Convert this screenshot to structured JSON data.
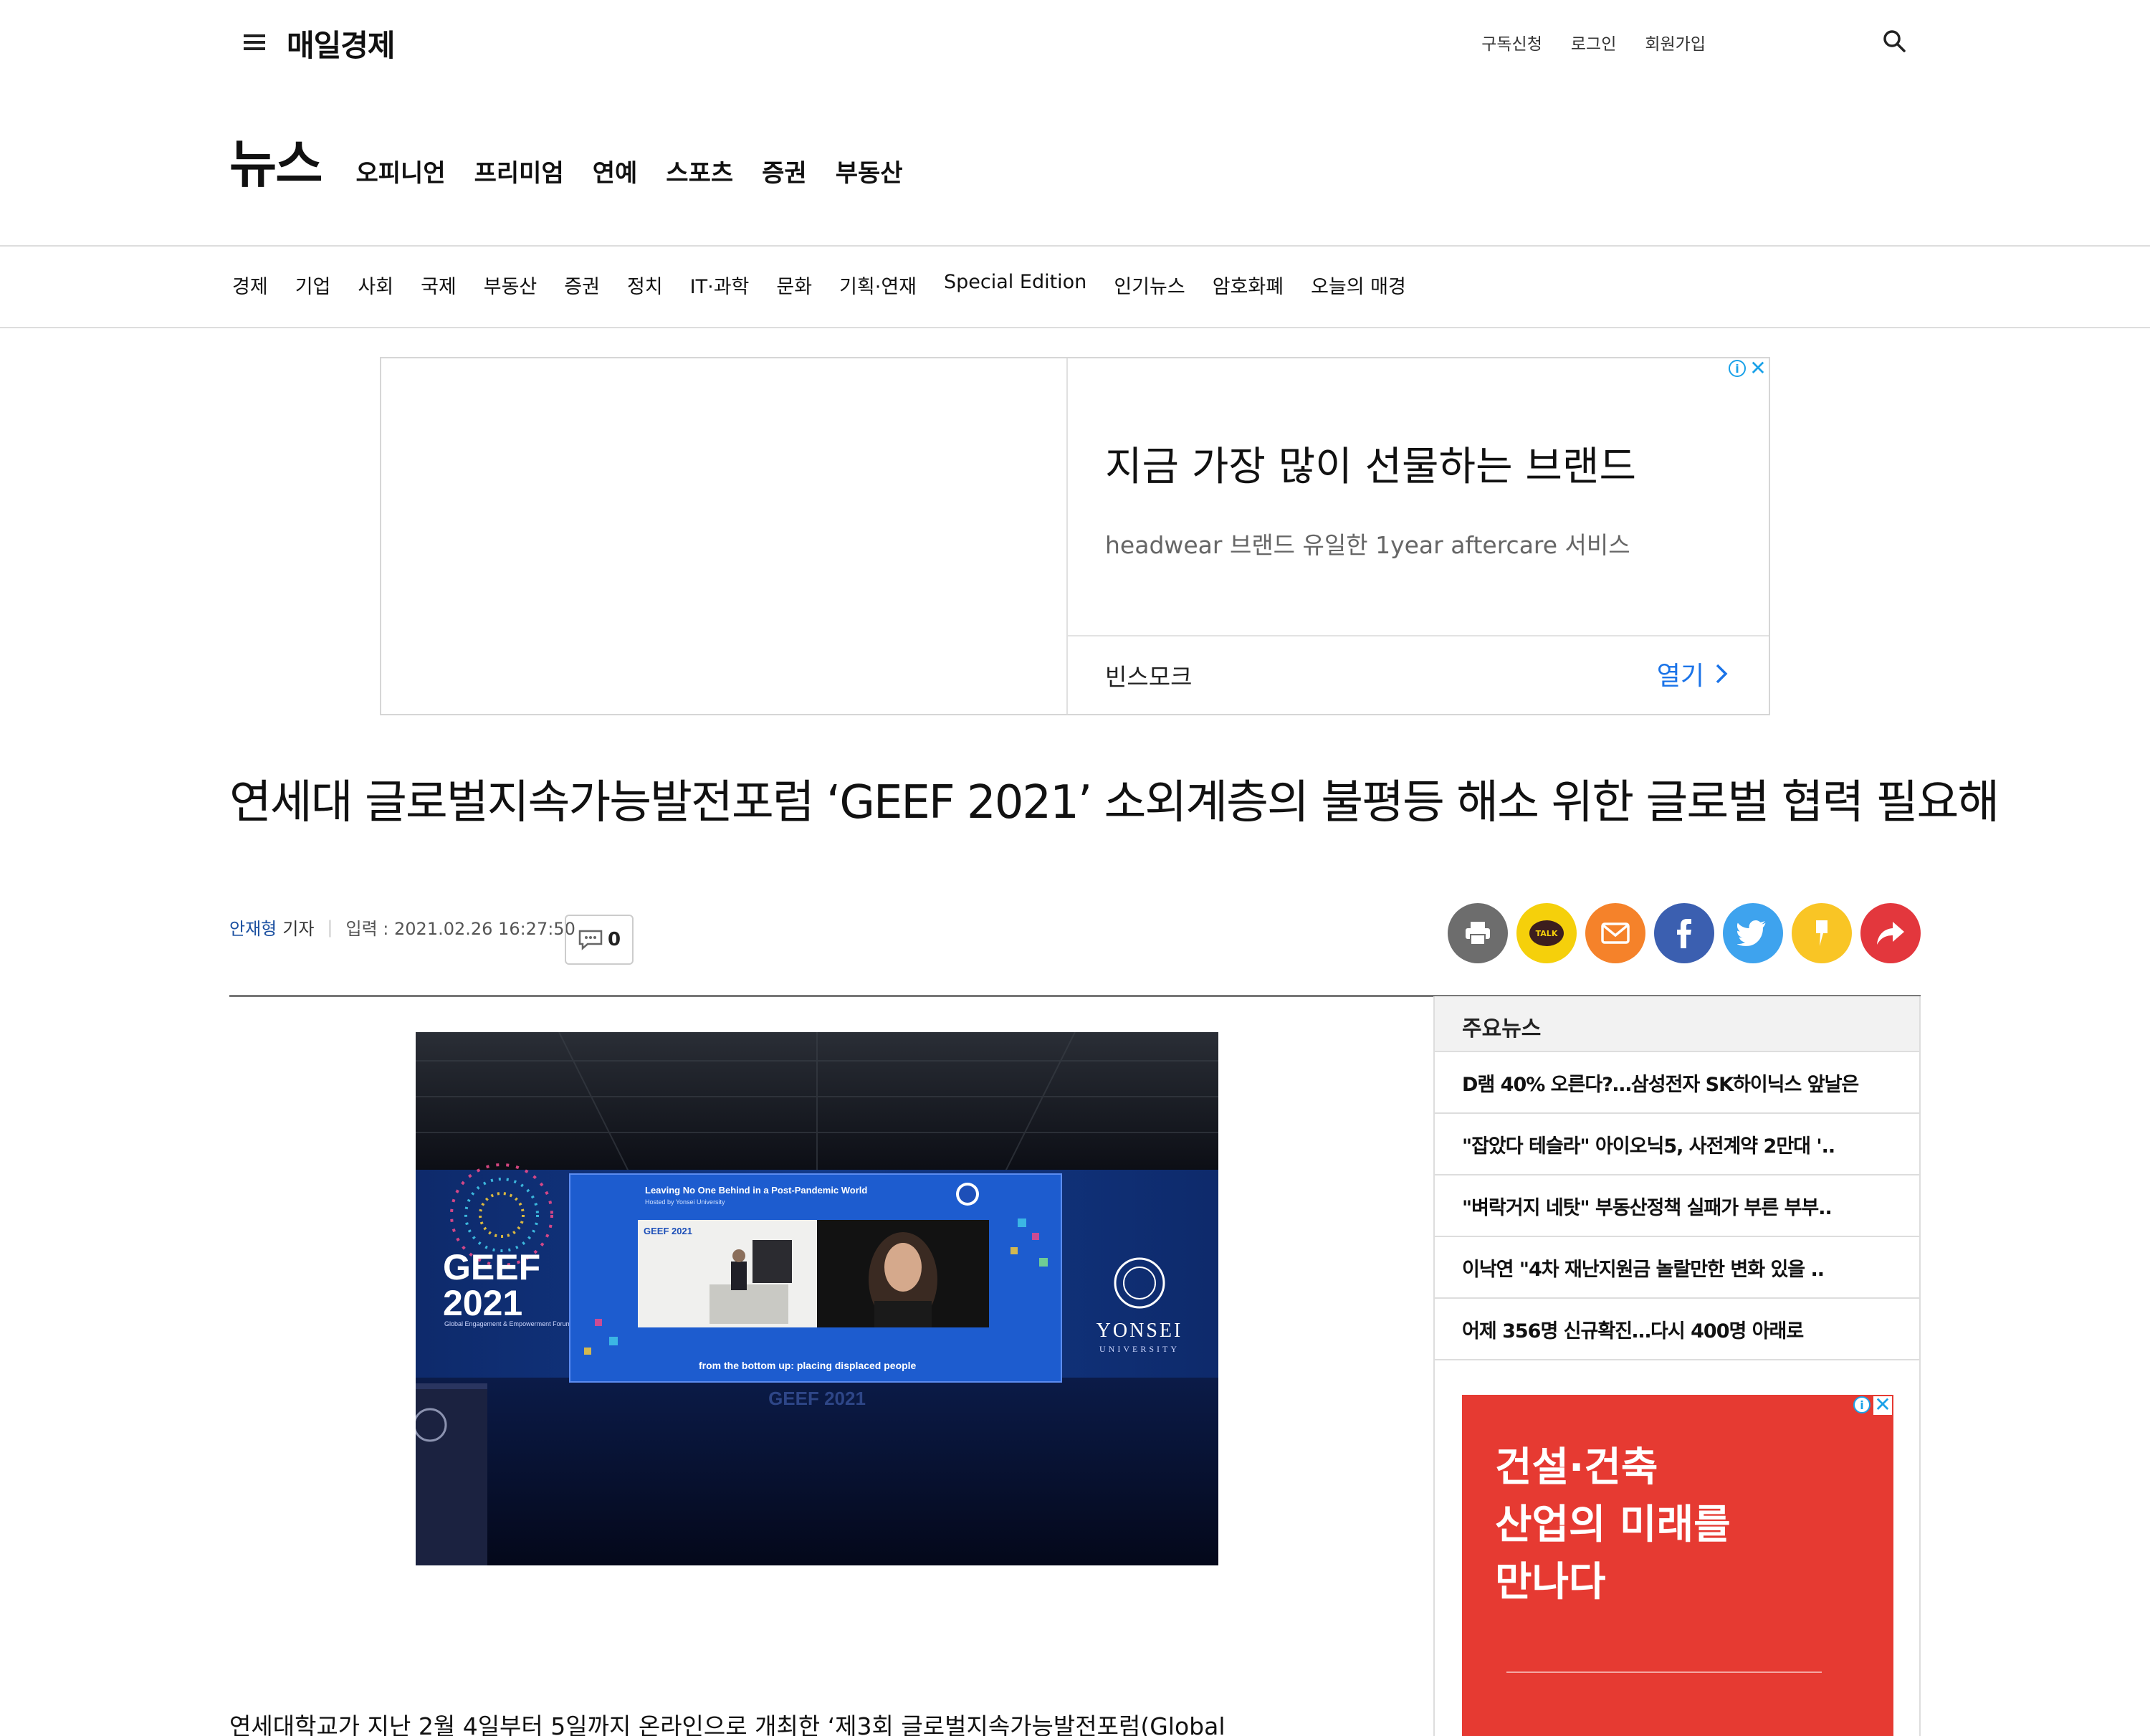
{
  "header": {
    "logo": "매일경제",
    "util_links": [
      "구독신청",
      "로그인",
      "회원가입"
    ]
  },
  "section": {
    "title": "뉴스",
    "tabs": [
      "오피니언",
      "프리미엄",
      "연예",
      "스포츠",
      "증권",
      "부동산"
    ]
  },
  "gnb": [
    "경제",
    "기업",
    "사회",
    "국제",
    "부동산",
    "증권",
    "정치",
    "IT·과학",
    "문화",
    "기획·연재",
    "Special Edition",
    "인기뉴스",
    "암호화폐",
    "오늘의 매경"
  ],
  "top_ad": {
    "headline": "지금 가장 많이 선물하는 브랜드",
    "subline": "headwear 브랜드 유일한 1year aftercare 서비스",
    "brand": "빈스모크",
    "cta": "열기",
    "adchoice_i": "i",
    "adchoice_x": "✕"
  },
  "article": {
    "headline": "연세대 글로벌지속가능발전포럼 ‘GEEF 2021’ 소외계층의 불평등 해소 위한 글로벌 협력 필요해",
    "author": "안재형",
    "author_role": "기자",
    "published": "입력 : 2021.02.26 16:27:50",
    "comment_count": "0",
    "body_first_line": "연세대학교가 지난 2월 4일부터 5일까지 온라인으로 개최한 ‘제3회 글로벌지속가능발전포럼(Global"
  },
  "share_buttons": [
    {
      "name": "print",
      "color": "#6d6d6d"
    },
    {
      "name": "kakaotalk",
      "color": "#f5d00b",
      "label": "TALK"
    },
    {
      "name": "email",
      "color": "#f5822a"
    },
    {
      "name": "facebook",
      "color": "#3b5fb0"
    },
    {
      "name": "twitter",
      "color": "#3ea3ee"
    },
    {
      "name": "kakaostory",
      "color": "#f9c525"
    },
    {
      "name": "share",
      "color": "#e3373d"
    }
  ],
  "photo": {
    "screen_title": "Leaving No One Behind in a Post-Pandemic World",
    "screen_subtitle": "Hosted by Yonsei University",
    "screen_caption": "from the bottom up: placing displaced people",
    "geef_big": "GEEF",
    "geef_year": "2021",
    "geef_desc": "Global Engagement & Empowerment Forum on Sustainable Development",
    "yonsei": "YONSEI",
    "yonsei_sub": "UNIVERSITY",
    "stage_label": "GEEF 2021",
    "inset_label": "GEEF 2021"
  },
  "sidebar": {
    "title": "주요뉴스",
    "items": [
      "D램 40% 오른다?…삼성전자 SK하이닉스 앞날은",
      "\"잡았다 테슬라\" 아이오닉5, 사전계약 2만대 '..",
      "\"벼락거지 네탓\" 부동산정책 실패가 부른 부부..",
      "이낙연 \"4차 재난지원금 놀랄만한 변화 있을 ..",
      "어제 356명 신규확진…다시 400명 아래로"
    ],
    "ad_lines": [
      "건설·건축",
      "산업의 미래를",
      "만나다"
    ]
  }
}
